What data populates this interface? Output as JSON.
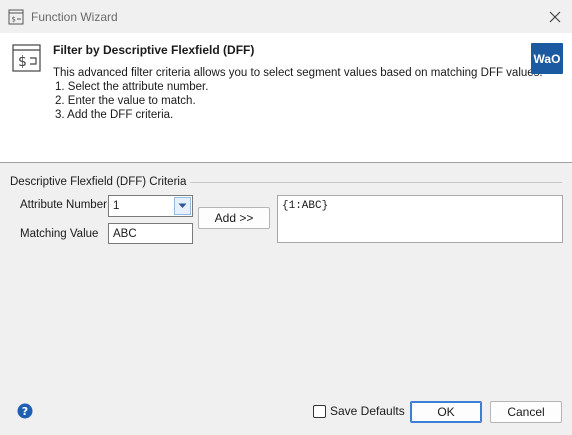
{
  "window": {
    "title": "Function Wizard",
    "app_icon": "function-wizard-icon",
    "close_icon": "close-icon"
  },
  "header": {
    "title": "Filter by Descriptive Flexfield (DFF)",
    "description": "This advanced filter criteria allows you to select segment values based on matching DFF values.",
    "steps": [
      "1. Select the attribute number.",
      "2. Enter the value to match.",
      "3. Add the DFF criteria."
    ],
    "icon": "dollar-card-icon",
    "logo_text": "WaO",
    "logo_color": "#1b5aa0"
  },
  "criteria": {
    "group_label": "Descriptive Flexfield (DFF) Criteria",
    "attribute_number_label": "Attribute Number",
    "attribute_number_value": "1",
    "matching_value_label": "Matching Value",
    "matching_value": "ABC",
    "add_button_label": "Add >>",
    "result_text": "{1:ABC}"
  },
  "footer": {
    "help_icon": "help-icon",
    "save_defaults_label": "Save Defaults",
    "save_defaults_checked": false,
    "ok_label": "OK",
    "cancel_label": "Cancel",
    "accent_color": "#3c7fd4"
  }
}
